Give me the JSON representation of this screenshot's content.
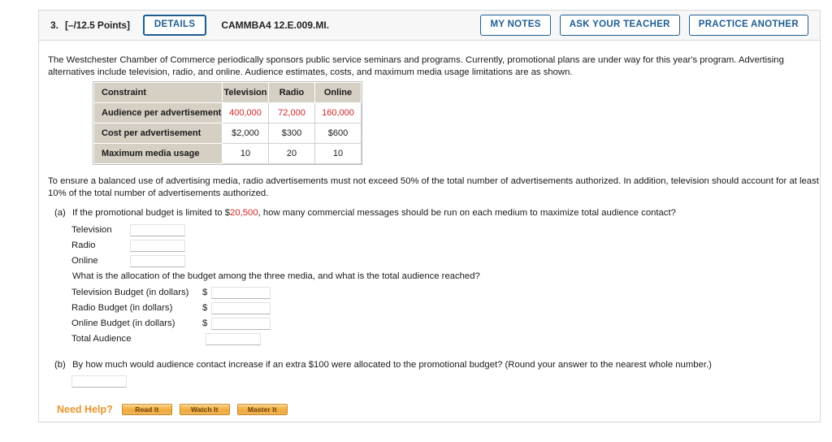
{
  "header": {
    "question_number": "3.",
    "points": "[–/12.5 Points]",
    "details_label": "DETAILS",
    "assignment_code": "CAMMBA4 12.E.009.MI.",
    "my_notes_label": "MY NOTES",
    "ask_teacher_label": "ASK YOUR TEACHER",
    "practice_another_label": "PRACTICE ANOTHER"
  },
  "problem": {
    "intro": "The Westchester Chamber of Commerce periodically sponsors public service seminars and programs. Currently, promotional plans are under way for this year's program. Advertising alternatives include television, radio, and online. Audience estimates, costs, and maximum media usage limitations are as shown.",
    "note": "To ensure a balanced use of advertising media, radio advertisements must not exceed 50% of the total number of advertisements authorized. In addition, television should account for at least 10% of the total number of advertisements authorized."
  },
  "table": {
    "headers": [
      "Constraint",
      "Television",
      "Radio",
      "Online"
    ],
    "rows": [
      {
        "label": "Audience per advertisement",
        "values": [
          "400,000",
          "72,000",
          "160,000"
        ],
        "red": true
      },
      {
        "label": "Cost per advertisement",
        "values": [
          "$2,000",
          "$300",
          "$600"
        ],
        "red": false
      },
      {
        "label": "Maximum media usage",
        "values": [
          "10",
          "20",
          "10"
        ],
        "red": false
      }
    ]
  },
  "part_a": {
    "marker": "(a)",
    "text_before": "If the promotional budget is limited to $",
    "budget_value": "20,500",
    "text_after": ", how many commercial messages should be run on each medium to maximize total audience contact?",
    "media_fields": [
      {
        "label": "Television",
        "value": ""
      },
      {
        "label": "Radio",
        "value": ""
      },
      {
        "label": "Online",
        "value": ""
      }
    ],
    "sub_question": "What is the allocation of the budget among the three media, and what is the total audience reached?",
    "budget_fields": [
      {
        "label": "Television Budget (in dollars)",
        "prefix": "$",
        "value": ""
      },
      {
        "label": "Radio Budget (in dollars)",
        "prefix": "$",
        "value": ""
      },
      {
        "label": "Online Budget (in dollars)",
        "prefix": "$",
        "value": ""
      },
      {
        "label": "Total Audience",
        "prefix": "",
        "value": ""
      }
    ]
  },
  "part_b": {
    "marker": "(b)",
    "text": "By how much would audience contact increase if an extra $100 were allocated to the promotional budget? (Round your answer to the nearest whole number.)",
    "answer_value": ""
  },
  "need_help": {
    "label": "Need Help?",
    "buttons": [
      "Read It",
      "Watch It",
      "Master It"
    ]
  }
}
